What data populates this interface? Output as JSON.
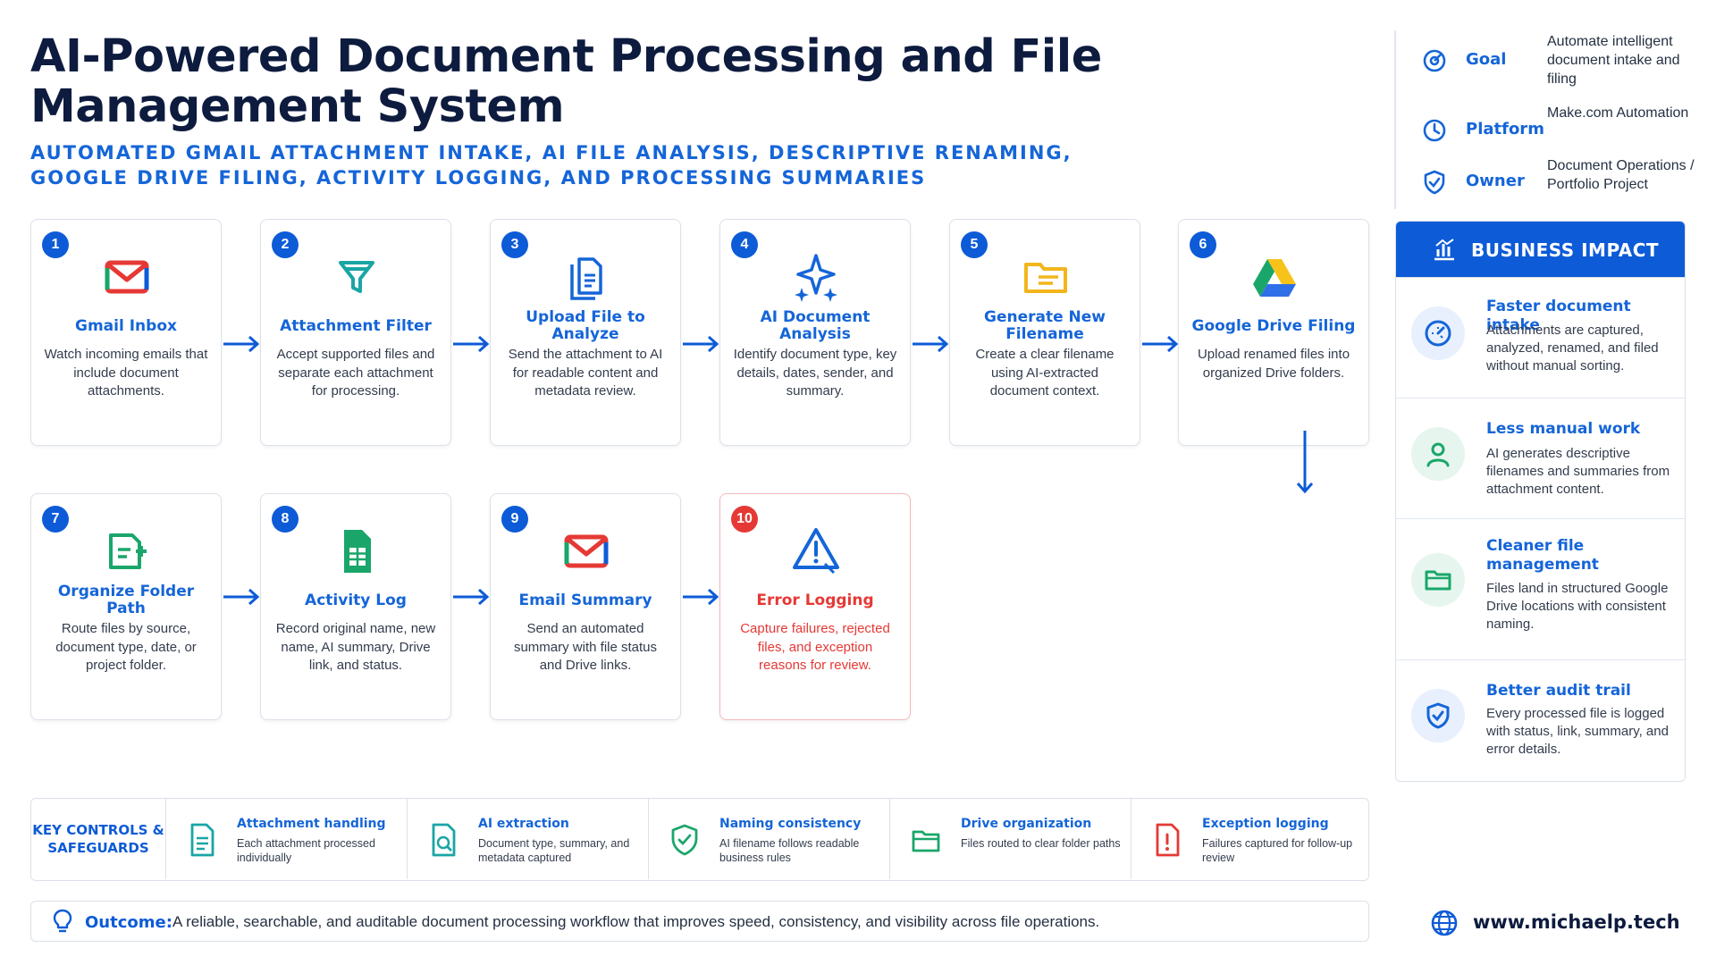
{
  "header": {
    "title": "AI-Powered Document Processing and File Management System",
    "subtitle": "AUTOMATED GMAIL ATTACHMENT INTAKE, AI FILE ANALYSIS, DESCRIPTIVE RENAMING, GOOGLE DRIVE FILING, ACTIVITY LOGGING, AND PROCESSING SUMMARIES"
  },
  "meta": [
    {
      "label": "Goal",
      "value": "Automate intelligent document intake and filing",
      "icon": "target-icon"
    },
    {
      "label": "Platform",
      "value": "Make.com Automation",
      "icon": "clock-icon"
    },
    {
      "label": "Owner",
      "value": "Document Operations / Portfolio Project",
      "icon": "shield-check-icon"
    }
  ],
  "steps": [
    {
      "num": "1",
      "title": "Gmail Inbox",
      "desc": "Watch incoming emails that include document attachments.",
      "icon": "gmail-icon"
    },
    {
      "num": "2",
      "title": "Attachment Filter",
      "desc": "Accept supported files and separate each attachment for processing.",
      "icon": "filter-icon"
    },
    {
      "num": "3",
      "title": "Upload File to Analyze",
      "desc": "Send the attachment to AI for readable content and metadata review.",
      "icon": "document-upload-icon"
    },
    {
      "num": "4",
      "title": "AI Document Analysis",
      "desc": "Identify document type, key details, dates, sender, and summary.",
      "icon": "ai-sparkle-icon"
    },
    {
      "num": "5",
      "title": "Generate New Filename",
      "desc": "Create a clear filename using AI-extracted document context.",
      "icon": "folder-icon"
    },
    {
      "num": "6",
      "title": "Google Drive Filing",
      "desc": "Upload renamed files into organized Drive folders.",
      "icon": "google-drive-icon"
    },
    {
      "num": "7",
      "title": "Organize Folder Path",
      "desc": "Route files by source, document type, date, or project folder.",
      "icon": "folder-route-icon"
    },
    {
      "num": "8",
      "title": "Activity Log",
      "desc": "Record original name, new name, AI summary, Drive link, and status.",
      "icon": "spreadsheet-icon"
    },
    {
      "num": "9",
      "title": "Email Summary",
      "desc": "Send an automated summary with file status and Drive links.",
      "icon": "gmail-icon"
    },
    {
      "num": "10",
      "title": "Error Logging",
      "desc": "Capture failures, rejected files, and exception reasons for review.",
      "icon": "warning-icon"
    }
  ],
  "business_impact": {
    "title": "BUSINESS IMPACT",
    "items": [
      {
        "name": "Faster document intake",
        "desc": "Attachments are captured, analyzed, renamed, and filed without manual sorting.",
        "icon": "speedometer-icon"
      },
      {
        "name": "Less manual work",
        "desc": "AI generates descriptive filenames and summaries from attachment content.",
        "icon": "person-icon"
      },
      {
        "name": "Cleaner file management",
        "desc": "Files land in structured Google Drive locations with consistent naming.",
        "icon": "folder-icon"
      },
      {
        "name": "Better audit trail",
        "desc": "Every processed file is logged with status, link, summary, and error details.",
        "icon": "shield-check-icon"
      }
    ]
  },
  "key_controls": {
    "label": "KEY CONTROLS & SAFEGUARDS",
    "items": [
      {
        "name": "Attachment handling",
        "desc": "Each attachment processed individually",
        "icon": "document-icon"
      },
      {
        "name": "AI extraction",
        "desc": "Document type, summary, and metadata captured",
        "icon": "document-search-icon"
      },
      {
        "name": "Naming consistency",
        "desc": "AI filename follows readable business rules",
        "icon": "shield-check-icon"
      },
      {
        "name": "Drive organization",
        "desc": "Files routed to clear folder paths",
        "icon": "folder-icon"
      },
      {
        "name": "Exception logging",
        "desc": "Failures captured for follow-up review",
        "icon": "document-alert-icon"
      }
    ]
  },
  "outcome": {
    "label": "Outcome:",
    "text": "A reliable, searchable, and auditable document processing workflow that improves speed, consistency, and visibility across file operations."
  },
  "footer": {
    "site": "www.michaelp.tech"
  },
  "colors": {
    "primary": "#0d5bd7",
    "accent_text": "#1565d8",
    "navy": "#0d1b3e",
    "error": "#e53935",
    "green": "#1aa66a",
    "teal": "#1aa5a5"
  }
}
